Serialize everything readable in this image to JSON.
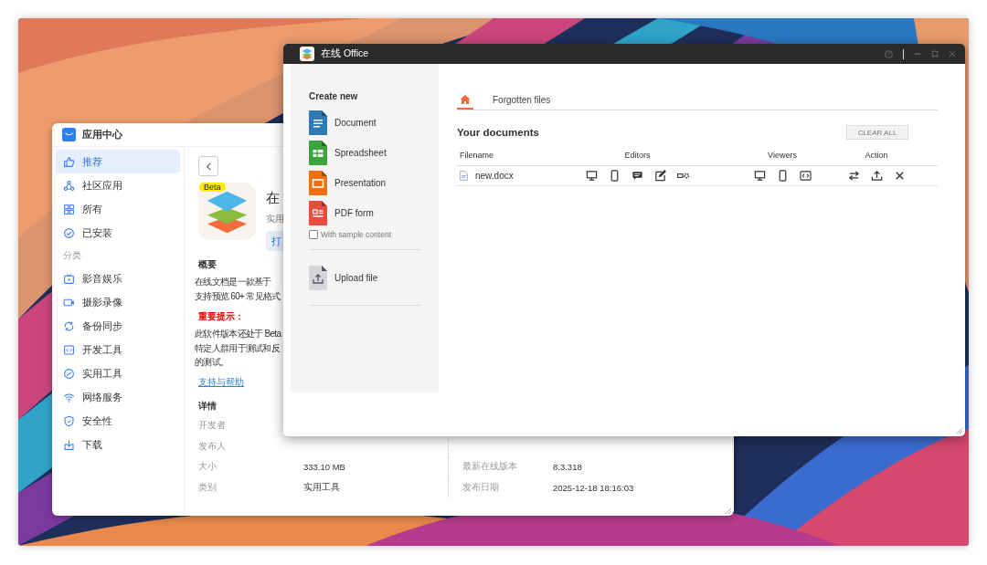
{
  "app_center": {
    "title": "应用中心",
    "sidebar": {
      "items": [
        {
          "label": "推荐",
          "selected": true
        },
        {
          "label": "社区应用",
          "selected": false
        },
        {
          "label": "所有",
          "selected": false
        },
        {
          "label": "已安装",
          "selected": false
        }
      ],
      "category_label": "分类",
      "categories": [
        {
          "label": "影音娱乐",
          "selected": false
        },
        {
          "label": "摄影录像",
          "selected": false
        },
        {
          "label": "备份同步",
          "selected": false
        },
        {
          "label": "开发工具",
          "selected": false
        },
        {
          "label": "实用工具",
          "selected": false
        },
        {
          "label": "网络服务",
          "selected": false
        },
        {
          "label": "安全性",
          "selected": false
        },
        {
          "label": "下载",
          "selected": false
        }
      ]
    },
    "detail": {
      "badge": "Beta",
      "app_name": "在",
      "app_type": "实用",
      "open_button": "打",
      "summary_heading": "概要",
      "summary_lines": [
        "在线文档是一款基于",
        "支持预览 60+ 常见格式"
      ],
      "notice_heading": "重要提示：",
      "notice_lines": [
        "此软件版本还处于 Beta",
        "特定人群用于测试和反",
        "的测试。"
      ],
      "support_link": "支持与帮助",
      "details_heading": "详情",
      "details_left": [
        {
          "label": "开发者"
        },
        {
          "label": "发布人"
        },
        {
          "label": "大小",
          "value": "333.10 MB"
        },
        {
          "label": "类别",
          "value": "实用工具"
        }
      ],
      "details_right": [
        {
          "label": "最新在线版本",
          "value": "8.3.318"
        },
        {
          "label": "发布日期",
          "value": "2025-12-18 18:16:03"
        }
      ]
    }
  },
  "office": {
    "title": "在线 Office",
    "create_heading": "Create new",
    "create_items": [
      {
        "kind": "document",
        "label": "Document"
      },
      {
        "kind": "spreadsheet",
        "label": "Spreadsheet"
      },
      {
        "kind": "presentation",
        "label": "Presentation"
      },
      {
        "kind": "pdf-form",
        "label": "PDF form"
      }
    ],
    "sample_checkbox": {
      "label": "With sample content",
      "checked": false
    },
    "upload": {
      "label": "Upload file"
    },
    "tabs": [
      {
        "kind": "home",
        "selected": true
      },
      {
        "kind": "text",
        "label": "Forgotten files",
        "selected": false
      }
    ],
    "heading": "Your documents",
    "clear_button": "CLEAR ALL",
    "columns": [
      "Filename",
      "Editors",
      "Viewers",
      "Action"
    ],
    "rows": [
      {
        "filename": "new.docx"
      }
    ]
  }
}
